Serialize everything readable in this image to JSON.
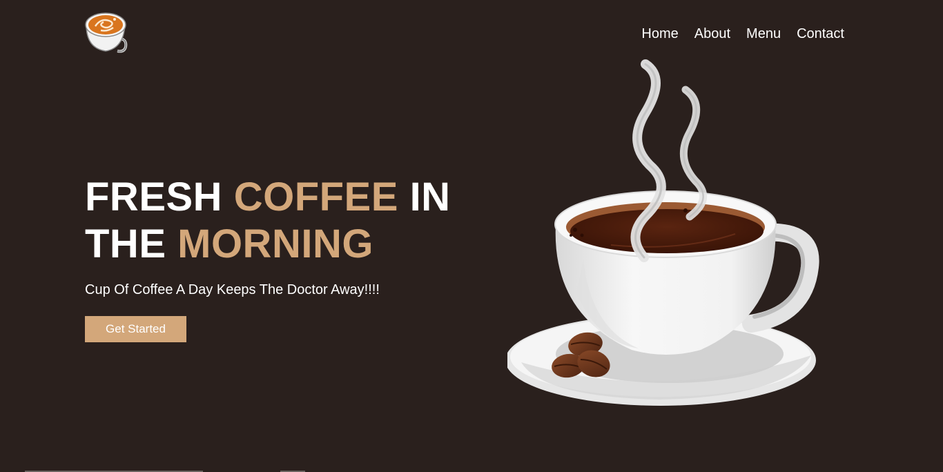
{
  "header": {
    "logo_icon": "latte-art-cup-icon",
    "nav": [
      {
        "label": "Home"
      },
      {
        "label": "About"
      },
      {
        "label": "Menu"
      },
      {
        "label": "Contact"
      }
    ]
  },
  "hero": {
    "headline": {
      "word1": "FRESH",
      "word2": "COFFEE",
      "word3": "IN",
      "word4": "THE",
      "word5": "MORNING"
    },
    "subtitle": "Cup Of Coffee A Day Keeps The Doctor Away!!!!",
    "cta_label": "Get Started",
    "illustration_icon": "coffee-cup-with-saucer-icon"
  },
  "colors": {
    "background": "#2a201d",
    "accent": "#d3a77a",
    "text": "#ffffff"
  }
}
